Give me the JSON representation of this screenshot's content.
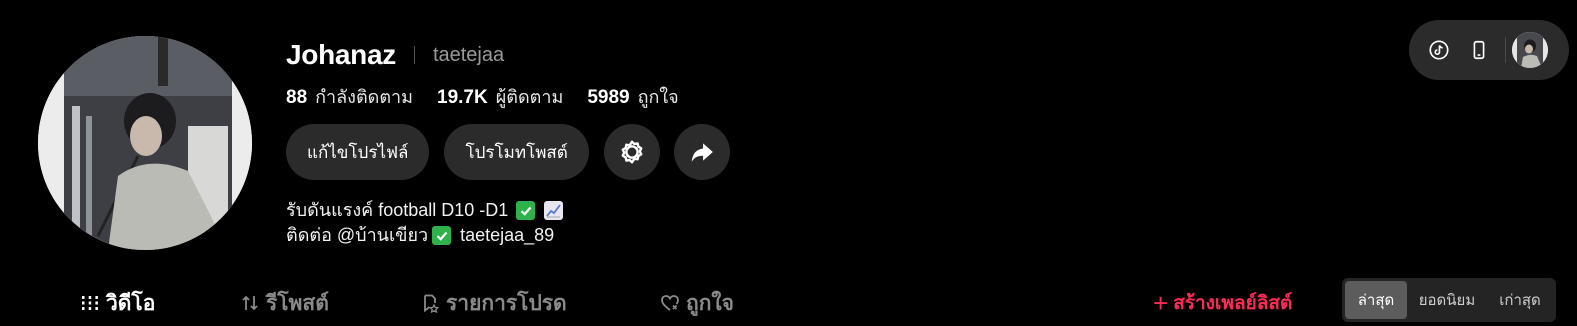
{
  "profile": {
    "display_name": "Johanaz",
    "username": "taetejaa",
    "stats": [
      {
        "value": "88",
        "label": "กำลังติดตาม"
      },
      {
        "value": "19.7K",
        "label": "ผู้ติดตาม"
      },
      {
        "value": "5989",
        "label": "ถูกใจ"
      }
    ],
    "bio_line1": "รับดันแรงค์ football D10 -D1",
    "bio_line2_prefix": "ติดต่อ @บ้านเขียว",
    "bio_line2_suffix": "taetejaa_89"
  },
  "actions": {
    "edit_profile": "แก้ไขโปรไฟล์",
    "promote_post": "โปรโมทโพสต์"
  },
  "tabs": [
    {
      "label": "วิดีโอ",
      "icon": "grid-icon",
      "active": true
    },
    {
      "label": "รีโพสต์",
      "icon": "repost-icon",
      "active": false
    },
    {
      "label": "รายการโปรด",
      "icon": "bookmark-icon",
      "active": false
    },
    {
      "label": "ถูกใจ",
      "icon": "heart-icon",
      "active": false
    }
  ],
  "create_playlist": {
    "plus": "+",
    "label": "สร้างเพลย์ลิสต์"
  },
  "sort": [
    {
      "label": "ล่าสุด",
      "active": true
    },
    {
      "label": "ยอดนิยม",
      "active": false
    },
    {
      "label": "เก่าสุด",
      "active": false
    }
  ],
  "top_controls": {
    "icons": [
      "tiktok-icon",
      "phone-icon"
    ]
  },
  "colors": {
    "background": "#000000",
    "button_bg": "#2b2b2b",
    "accent": "#fe2c55",
    "muted": "#9a9a9a"
  }
}
